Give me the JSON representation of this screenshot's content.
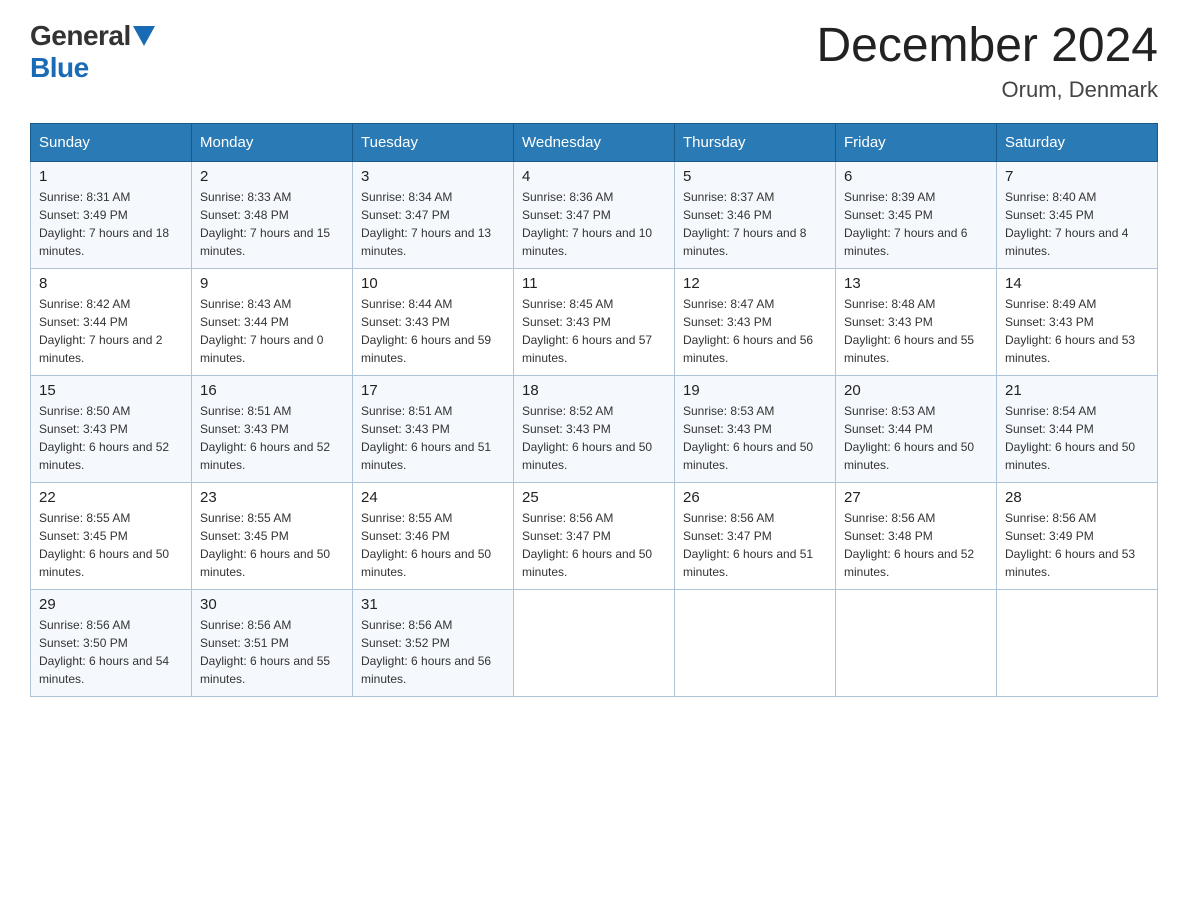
{
  "header": {
    "logo_general": "General",
    "logo_blue": "Blue",
    "title": "December 2024",
    "subtitle": "Orum, Denmark"
  },
  "days_of_week": [
    "Sunday",
    "Monday",
    "Tuesday",
    "Wednesday",
    "Thursday",
    "Friday",
    "Saturday"
  ],
  "weeks": [
    [
      {
        "day": "1",
        "sunrise": "8:31 AM",
        "sunset": "3:49 PM",
        "daylight": "7 hours and 18 minutes."
      },
      {
        "day": "2",
        "sunrise": "8:33 AM",
        "sunset": "3:48 PM",
        "daylight": "7 hours and 15 minutes."
      },
      {
        "day": "3",
        "sunrise": "8:34 AM",
        "sunset": "3:47 PM",
        "daylight": "7 hours and 13 minutes."
      },
      {
        "day": "4",
        "sunrise": "8:36 AM",
        "sunset": "3:47 PM",
        "daylight": "7 hours and 10 minutes."
      },
      {
        "day": "5",
        "sunrise": "8:37 AM",
        "sunset": "3:46 PM",
        "daylight": "7 hours and 8 minutes."
      },
      {
        "day": "6",
        "sunrise": "8:39 AM",
        "sunset": "3:45 PM",
        "daylight": "7 hours and 6 minutes."
      },
      {
        "day": "7",
        "sunrise": "8:40 AM",
        "sunset": "3:45 PM",
        "daylight": "7 hours and 4 minutes."
      }
    ],
    [
      {
        "day": "8",
        "sunrise": "8:42 AM",
        "sunset": "3:44 PM",
        "daylight": "7 hours and 2 minutes."
      },
      {
        "day": "9",
        "sunrise": "8:43 AM",
        "sunset": "3:44 PM",
        "daylight": "7 hours and 0 minutes."
      },
      {
        "day": "10",
        "sunrise": "8:44 AM",
        "sunset": "3:43 PM",
        "daylight": "6 hours and 59 minutes."
      },
      {
        "day": "11",
        "sunrise": "8:45 AM",
        "sunset": "3:43 PM",
        "daylight": "6 hours and 57 minutes."
      },
      {
        "day": "12",
        "sunrise": "8:47 AM",
        "sunset": "3:43 PM",
        "daylight": "6 hours and 56 minutes."
      },
      {
        "day": "13",
        "sunrise": "8:48 AM",
        "sunset": "3:43 PM",
        "daylight": "6 hours and 55 minutes."
      },
      {
        "day": "14",
        "sunrise": "8:49 AM",
        "sunset": "3:43 PM",
        "daylight": "6 hours and 53 minutes."
      }
    ],
    [
      {
        "day": "15",
        "sunrise": "8:50 AM",
        "sunset": "3:43 PM",
        "daylight": "6 hours and 52 minutes."
      },
      {
        "day": "16",
        "sunrise": "8:51 AM",
        "sunset": "3:43 PM",
        "daylight": "6 hours and 52 minutes."
      },
      {
        "day": "17",
        "sunrise": "8:51 AM",
        "sunset": "3:43 PM",
        "daylight": "6 hours and 51 minutes."
      },
      {
        "day": "18",
        "sunrise": "8:52 AM",
        "sunset": "3:43 PM",
        "daylight": "6 hours and 50 minutes."
      },
      {
        "day": "19",
        "sunrise": "8:53 AM",
        "sunset": "3:43 PM",
        "daylight": "6 hours and 50 minutes."
      },
      {
        "day": "20",
        "sunrise": "8:53 AM",
        "sunset": "3:44 PM",
        "daylight": "6 hours and 50 minutes."
      },
      {
        "day": "21",
        "sunrise": "8:54 AM",
        "sunset": "3:44 PM",
        "daylight": "6 hours and 50 minutes."
      }
    ],
    [
      {
        "day": "22",
        "sunrise": "8:55 AM",
        "sunset": "3:45 PM",
        "daylight": "6 hours and 50 minutes."
      },
      {
        "day": "23",
        "sunrise": "8:55 AM",
        "sunset": "3:45 PM",
        "daylight": "6 hours and 50 minutes."
      },
      {
        "day": "24",
        "sunrise": "8:55 AM",
        "sunset": "3:46 PM",
        "daylight": "6 hours and 50 minutes."
      },
      {
        "day": "25",
        "sunrise": "8:56 AM",
        "sunset": "3:47 PM",
        "daylight": "6 hours and 50 minutes."
      },
      {
        "day": "26",
        "sunrise": "8:56 AM",
        "sunset": "3:47 PM",
        "daylight": "6 hours and 51 minutes."
      },
      {
        "day": "27",
        "sunrise": "8:56 AM",
        "sunset": "3:48 PM",
        "daylight": "6 hours and 52 minutes."
      },
      {
        "day": "28",
        "sunrise": "8:56 AM",
        "sunset": "3:49 PM",
        "daylight": "6 hours and 53 minutes."
      }
    ],
    [
      {
        "day": "29",
        "sunrise": "8:56 AM",
        "sunset": "3:50 PM",
        "daylight": "6 hours and 54 minutes."
      },
      {
        "day": "30",
        "sunrise": "8:56 AM",
        "sunset": "3:51 PM",
        "daylight": "6 hours and 55 minutes."
      },
      {
        "day": "31",
        "sunrise": "8:56 AM",
        "sunset": "3:52 PM",
        "daylight": "6 hours and 56 minutes."
      },
      null,
      null,
      null,
      null
    ]
  ]
}
